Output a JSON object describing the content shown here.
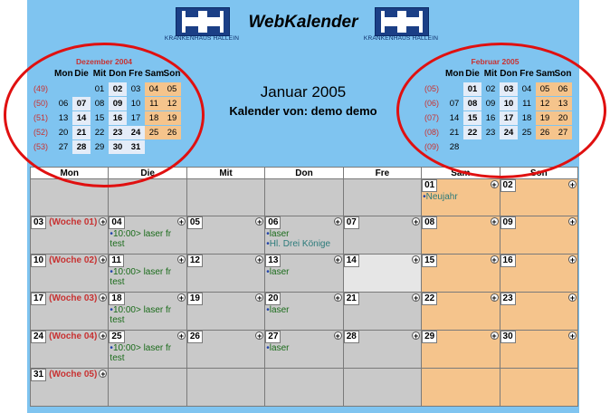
{
  "app": {
    "title": "WebKalender",
    "logo_caption": "KRANKENHAUS HALLEIN"
  },
  "colors": {
    "page_bg": "#7fc4f0",
    "weekend": "#f5c48c",
    "weekday": "#c9c9c9",
    "week_label": "#c83232",
    "event_text": "#1a6b1a",
    "annotation_red": "#e01010"
  },
  "header": {
    "month_title": "Januar 2005",
    "owner_line": "Kalender von: demo demo"
  },
  "mini_prev": {
    "name": "Dezember 2004",
    "days": [
      "Mon",
      "Die",
      "Mit",
      "Don",
      "Fre",
      "Sam",
      "Son"
    ],
    "rows": [
      {
        "wk": "(49)",
        "cells": [
          "",
          "",
          "01",
          "02",
          "03",
          "04",
          "05"
        ]
      },
      {
        "wk": "(50)",
        "cells": [
          "06",
          "07",
          "08",
          "09",
          "10",
          "11",
          "12"
        ]
      },
      {
        "wk": "(51)",
        "cells": [
          "13",
          "14",
          "15",
          "16",
          "17",
          "18",
          "19"
        ]
      },
      {
        "wk": "(52)",
        "cells": [
          "20",
          "21",
          "22",
          "23",
          "24",
          "25",
          "26"
        ]
      },
      {
        "wk": "(53)",
        "cells": [
          "27",
          "28",
          "29",
          "30",
          "31",
          "",
          ""
        ]
      }
    ]
  },
  "mini_next": {
    "name": "Februar 2005",
    "days": [
      "Mon",
      "Die",
      "Mit",
      "Don",
      "Fre",
      "Sam",
      "Son"
    ],
    "rows": [
      {
        "wk": "(05)",
        "cells": [
          "",
          "01",
          "02",
          "03",
          "04",
          "05",
          "06"
        ]
      },
      {
        "wk": "(06)",
        "cells": [
          "07",
          "08",
          "09",
          "10",
          "11",
          "12",
          "13"
        ]
      },
      {
        "wk": "(07)",
        "cells": [
          "14",
          "15",
          "16",
          "17",
          "18",
          "19",
          "20"
        ]
      },
      {
        "wk": "(08)",
        "cells": [
          "21",
          "22",
          "23",
          "24",
          "25",
          "26",
          "27"
        ]
      },
      {
        "wk": "(09)",
        "cells": [
          "28",
          "",
          "",
          "",
          "",
          "",
          ""
        ]
      }
    ]
  },
  "grid": {
    "headers": [
      "Mon",
      "Die",
      "Mit",
      "Don",
      "Fre",
      "Sam",
      "Son"
    ],
    "weeks": [
      {
        "label": "",
        "days": [
          {
            "num": ""
          },
          {
            "num": ""
          },
          {
            "num": ""
          },
          {
            "num": ""
          },
          {
            "num": ""
          },
          {
            "num": "01",
            "events": [
              "Neujahr"
            ],
            "holiday": true
          },
          {
            "num": "02"
          }
        ]
      },
      {
        "label": "(Woche 01)",
        "days": [
          {
            "num": "03"
          },
          {
            "num": "04",
            "events": [
              "10:00> laser fr test"
            ]
          },
          {
            "num": "05"
          },
          {
            "num": "06",
            "events": [
              "laser",
              "Hl. Drei Könige"
            ]
          },
          {
            "num": "07"
          },
          {
            "num": "08"
          },
          {
            "num": "09"
          }
        ]
      },
      {
        "label": "(Woche 02)",
        "days": [
          {
            "num": "10"
          },
          {
            "num": "11",
            "events": [
              "10:00> laser fr test"
            ]
          },
          {
            "num": "12"
          },
          {
            "num": "13",
            "events": [
              "laser"
            ]
          },
          {
            "num": "14",
            "today": true
          },
          {
            "num": "15"
          },
          {
            "num": "16"
          }
        ]
      },
      {
        "label": "(Woche 03)",
        "days": [
          {
            "num": "17"
          },
          {
            "num": "18",
            "events": [
              "10:00> laser fr test"
            ]
          },
          {
            "num": "19"
          },
          {
            "num": "20",
            "events": [
              "laser"
            ]
          },
          {
            "num": "21"
          },
          {
            "num": "22"
          },
          {
            "num": "23"
          }
        ]
      },
      {
        "label": "(Woche 04)",
        "days": [
          {
            "num": "24"
          },
          {
            "num": "25",
            "events": [
              "10:00> laser fr test"
            ]
          },
          {
            "num": "26"
          },
          {
            "num": "27",
            "events": [
              "laser"
            ]
          },
          {
            "num": "28"
          },
          {
            "num": "29"
          },
          {
            "num": "30"
          }
        ]
      },
      {
        "label": "(Woche 05)",
        "days": [
          {
            "num": "31"
          },
          {
            "num": ""
          },
          {
            "num": ""
          },
          {
            "num": ""
          },
          {
            "num": ""
          },
          {
            "num": ""
          },
          {
            "num": ""
          }
        ]
      }
    ]
  }
}
